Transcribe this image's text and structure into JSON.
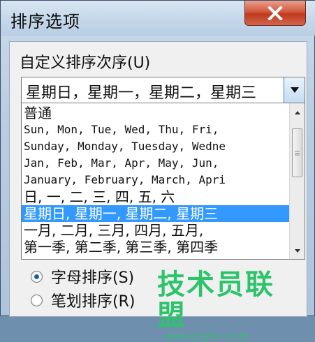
{
  "window": {
    "title": "排序选项",
    "close_icon": "close-icon"
  },
  "custom_order": {
    "label": "自定义排序次序(U)",
    "selected_value": "星期日，星期一，星期二，星期三",
    "list_items": [
      "普通",
      "Sun, Mon, Tue, Wed, Thu, Fri,",
      "Sunday, Monday, Tuesday, Wedne",
      "Jan, Feb, Mar, Apr, May, Jun,",
      "January, February, March, Apri",
      "日, 一, 二, 三, 四, 五, 六",
      "星期日, 星期一, 星期二, 星期三",
      "一月, 二月, 三月, 四月, 五月,",
      "第一季, 第二季, 第三季, 第四季"
    ],
    "selected_index": 6
  },
  "sort_method": {
    "options": [
      "字母排序(S)",
      "笔划排序(R)"
    ],
    "checked_index": 0
  },
  "watermark": {
    "text": "技术员联盟",
    "url": "www.jsgho.com"
  },
  "colors": {
    "selection": "#3399ff",
    "watermark": "#2dc36b",
    "close_button": "#c03a1f"
  }
}
